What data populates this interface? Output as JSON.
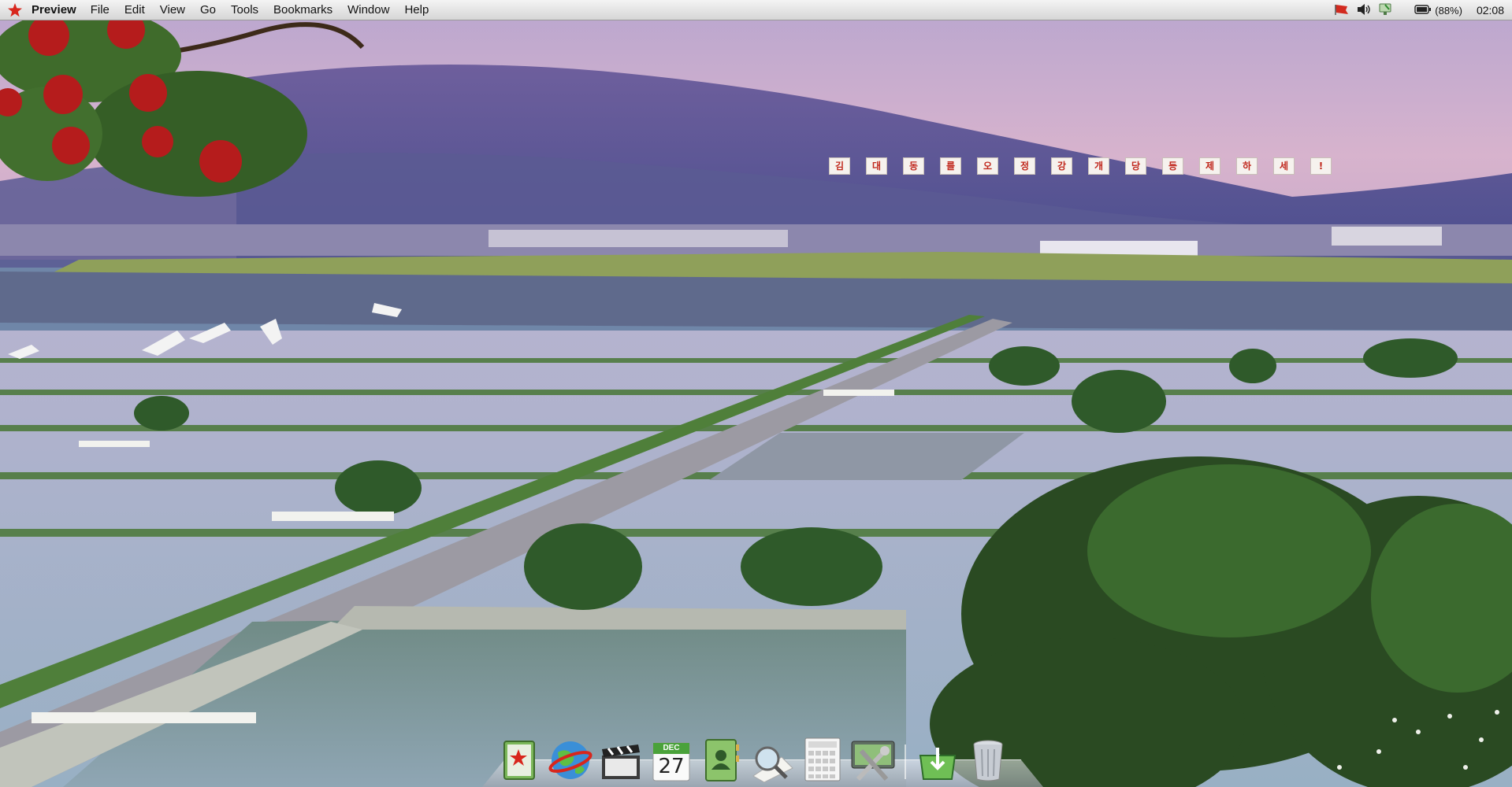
{
  "menubar": {
    "apple_icon": "red-star-icon",
    "app_name": "Preview",
    "menus": [
      "File",
      "Edit",
      "View",
      "Go",
      "Tools",
      "Bookmarks",
      "Window",
      "Help"
    ],
    "status": {
      "flag_icon": "flag-icon",
      "volume_icon": "volume-icon",
      "network_icon": "network-icon",
      "battery_icon": "battery-icon",
      "battery_text": "(88%)",
      "clock": "02:08"
    }
  },
  "wallpaper": {
    "slogan_chars": [
      "김",
      "대",
      "동",
      "를",
      "오",
      "정",
      "강",
      "개",
      "당",
      "등",
      "제",
      "하",
      "세",
      "!"
    ]
  },
  "dock": {
    "items": [
      {
        "name": "address-book-app",
        "icon": "book-icon"
      },
      {
        "name": "browser-app",
        "icon": "globe-icon"
      },
      {
        "name": "movie-app",
        "icon": "clapperboard-icon"
      },
      {
        "name": "calendar-app",
        "icon": "calendar-icon",
        "month": "DEC",
        "day": "27"
      },
      {
        "name": "contacts-app",
        "icon": "contacts-icon"
      },
      {
        "name": "preview-app",
        "icon": "magnifier-icon"
      },
      {
        "name": "calculator-app",
        "icon": "calculator-icon"
      },
      {
        "name": "system-preferences-app",
        "icon": "tools-icon"
      },
      {
        "name": "installer-app",
        "icon": "installer-icon"
      },
      {
        "name": "trash",
        "icon": "trash-icon"
      }
    ]
  }
}
